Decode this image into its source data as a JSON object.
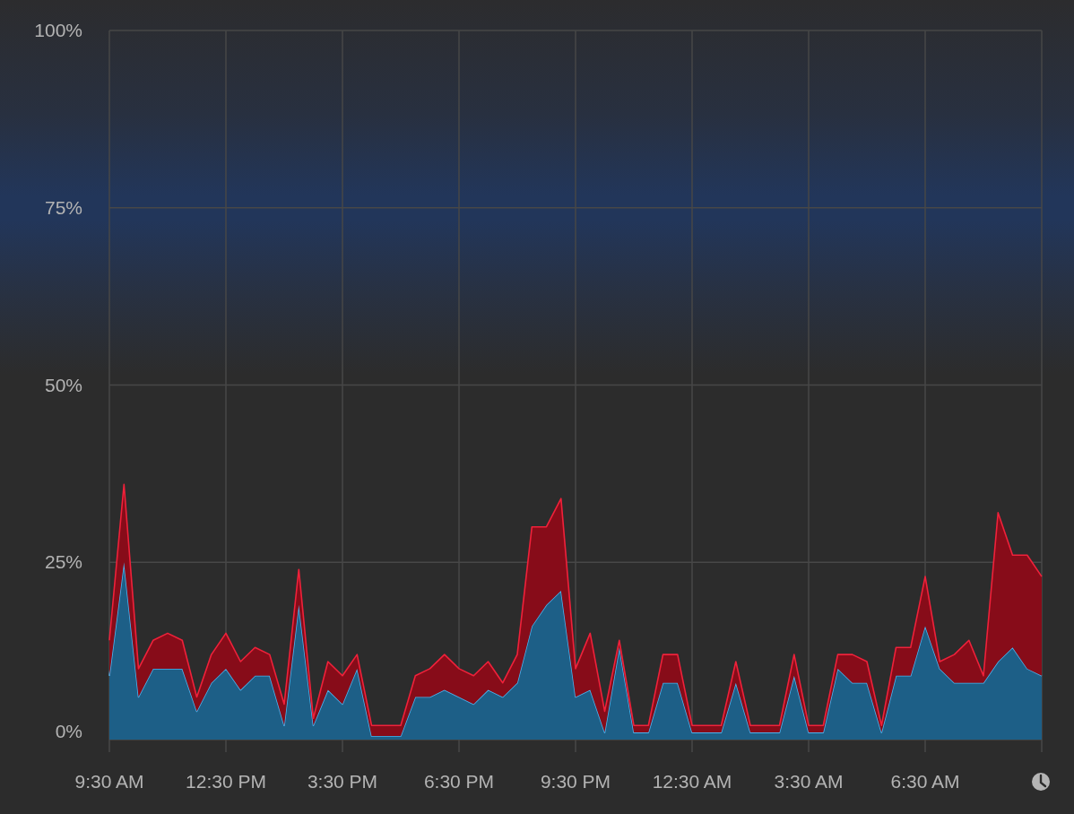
{
  "chart": {
    "chart_data": {
      "type": "area",
      "stacked": true,
      "grid": true,
      "categories": [
        "9:30 AM",
        null,
        null,
        null,
        null,
        null,
        null,
        null,
        "12:30 PM",
        null,
        null,
        null,
        null,
        null,
        null,
        null,
        "3:30 PM",
        null,
        null,
        null,
        null,
        null,
        null,
        null,
        "6:30 PM",
        null,
        null,
        null,
        null,
        null,
        null,
        null,
        "9:30 PM",
        null,
        null,
        null,
        null,
        null,
        null,
        null,
        "12:30 AM",
        null,
        null,
        null,
        null,
        null,
        null,
        null,
        "3:30 AM",
        null,
        null,
        null,
        null,
        null,
        null,
        null,
        "6:30 AM",
        null,
        null,
        null,
        null,
        null,
        null,
        null,
        null
      ],
      "series": [
        {
          "color": "#4ab4ef",
          "values": [
            9,
            25,
            6,
            10,
            10,
            10,
            4,
            8,
            10,
            7,
            9,
            9,
            2,
            19,
            2,
            7,
            5,
            10,
            0.5,
            0.5,
            0.5,
            6,
            6,
            7,
            6,
            5,
            7,
            6,
            8,
            16,
            19,
            21,
            6,
            7,
            1,
            13,
            1,
            1,
            8,
            8,
            1,
            1,
            1,
            8,
            1,
            1,
            1,
            9,
            1,
            1,
            10,
            8,
            8,
            1,
            9,
            9,
            16,
            10,
            8,
            8,
            8,
            11,
            13,
            10,
            9
          ]
        },
        {
          "color": "#f0213a",
          "values": [
            5,
            11,
            4,
            4,
            5,
            4,
            2,
            4,
            5,
            4,
            4,
            3,
            3,
            5,
            1,
            4,
            4,
            2,
            1.5,
            1.5,
            1.5,
            3,
            4,
            5,
            4,
            4,
            4,
            2,
            4,
            14,
            11,
            13,
            4,
            8,
            3,
            1,
            1,
            1,
            4,
            4,
            1,
            1,
            1,
            3,
            1,
            1,
            1,
            3,
            1,
            1,
            2,
            4,
            3,
            1,
            4,
            4,
            7,
            1,
            4,
            6,
            1,
            21,
            13,
            16,
            14
          ]
        }
      ],
      "ylim": [
        0,
        100
      ],
      "yticks": [
        {
          "value": 0,
          "label": "0%"
        },
        {
          "value": 25,
          "label": "25%"
        },
        {
          "value": 50,
          "label": "50%"
        },
        {
          "value": 75,
          "label": "75%"
        },
        {
          "value": 100,
          "label": "100%"
        }
      ]
    }
  }
}
